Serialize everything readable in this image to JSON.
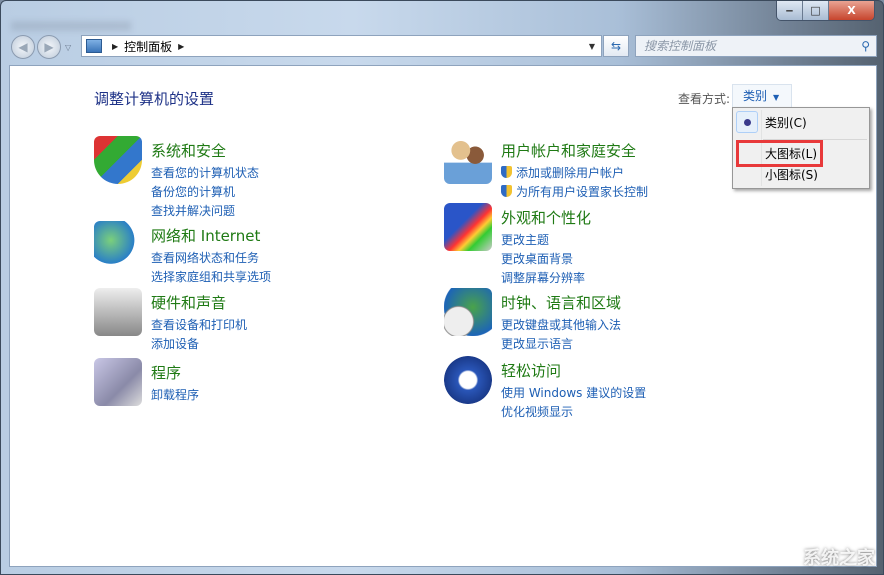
{
  "window": {
    "minimize": "‒",
    "maximize": "□",
    "close": "X"
  },
  "toolbar": {
    "back": "◀",
    "forward": "▶",
    "history": "▽",
    "breadcrumb": "控制面板",
    "sep": "▶",
    "dropdown": "▼",
    "refresh": "⇆",
    "search_placeholder": "搜索控制面板",
    "search_icon": "⚲"
  },
  "main": {
    "title": "调整计算机的设置",
    "view_label": "查看方式:",
    "view_value": "类别",
    "view_caret": "▼"
  },
  "categories": [
    {
      "title": "系统和安全",
      "links": [
        "查看您的计算机状态",
        "备份您的计算机",
        "查找并解决问题"
      ]
    },
    {
      "title": "网络和 Internet",
      "links": [
        "查看网络状态和任务",
        "选择家庭组和共享选项"
      ]
    },
    {
      "title": "硬件和声音",
      "links": [
        "查看设备和打印机",
        "添加设备"
      ]
    },
    {
      "title": "程序",
      "links": [
        "卸载程序"
      ]
    },
    {
      "title": "用户帐户和家庭安全",
      "links": [
        "添加或删除用户帐户",
        "为所有用户设置家长控制"
      ]
    },
    {
      "title": "外观和个性化",
      "links": [
        "更改主题",
        "更改桌面背景",
        "调整屏幕分辨率"
      ]
    },
    {
      "title": "时钟、语言和区域",
      "links": [
        "更改键盘或其他输入法",
        "更改显示语言"
      ]
    },
    {
      "title": "轻松访问",
      "links": [
        "使用 Windows 建议的设置",
        "优化视频显示"
      ]
    }
  ],
  "view_menu": {
    "items": [
      "类别(C)",
      "大图标(L)",
      "小图标(S)"
    ],
    "selected": "类别(C)",
    "highlighted": "大图标(L)"
  },
  "watermark": "系统之家",
  "colors": {
    "link": "#1e5fb4",
    "category": "#1f7a14",
    "title": "#1e3287",
    "highlight": "#e8393a"
  }
}
